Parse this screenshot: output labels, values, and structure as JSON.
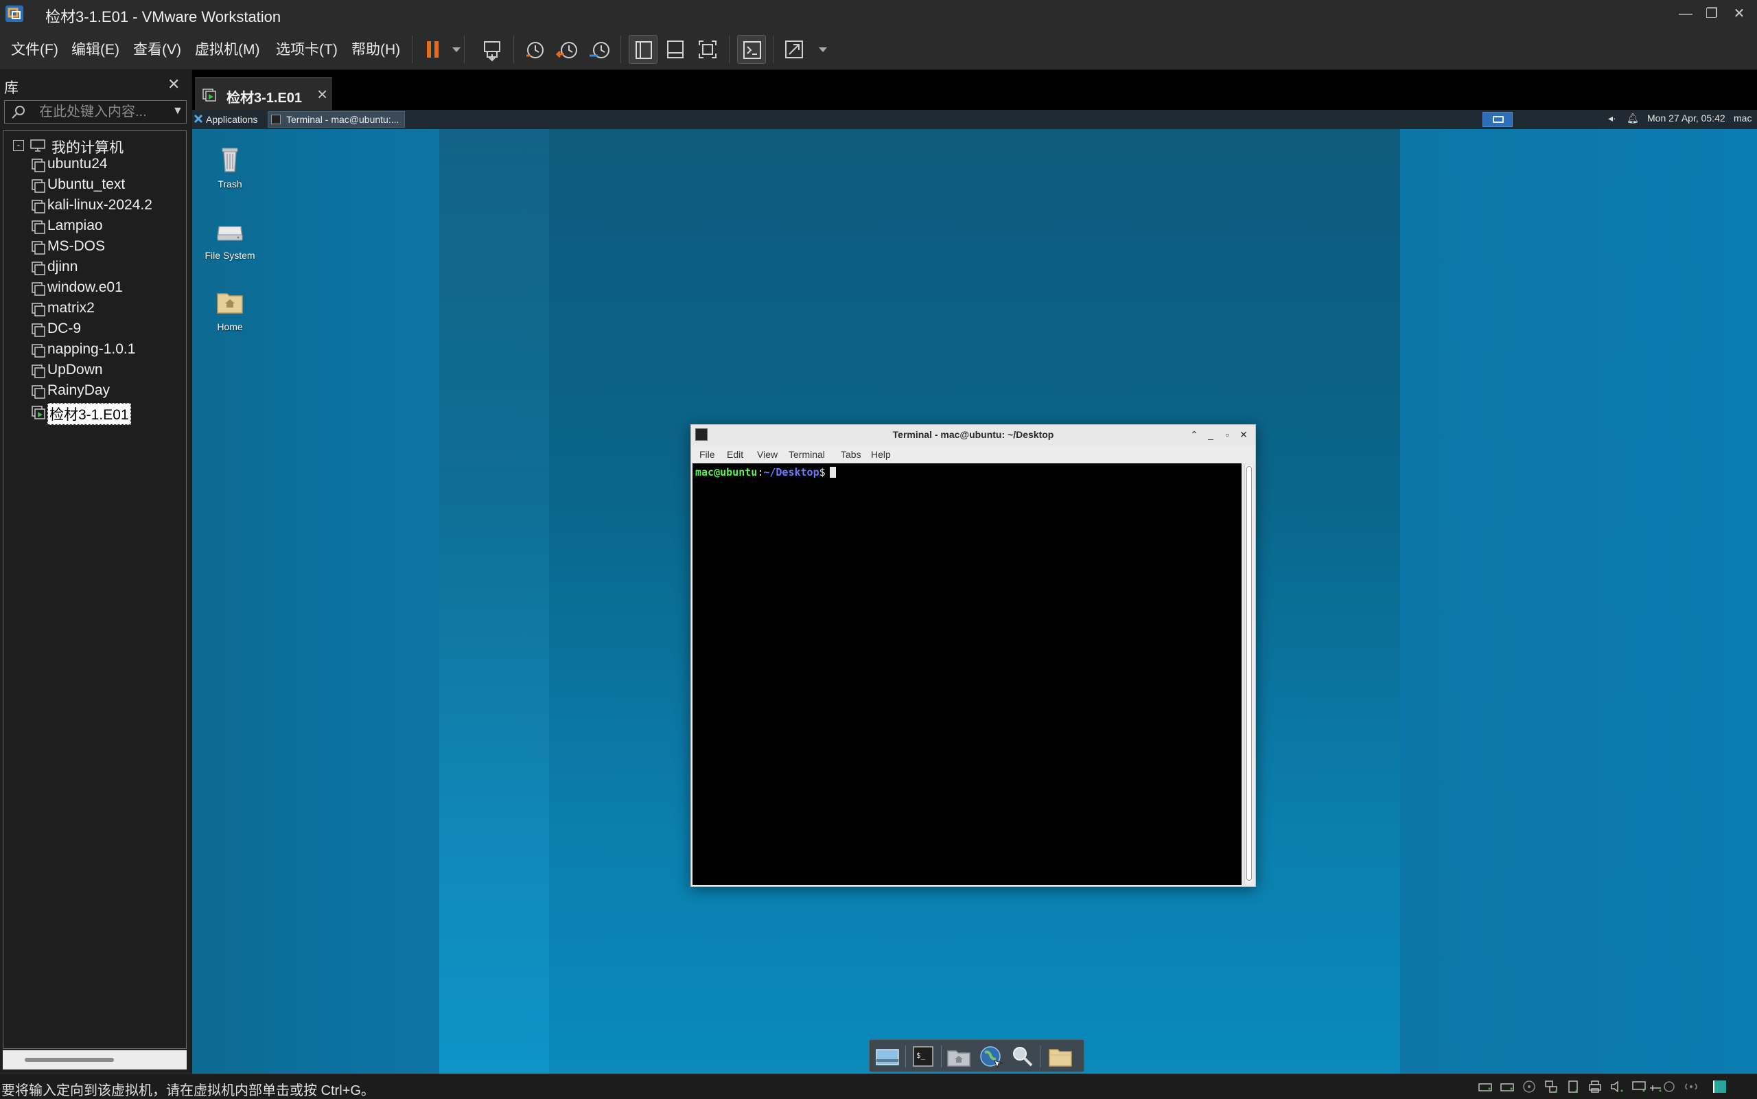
{
  "window": {
    "title": "检材3-1.E01 - VMware Workstation",
    "controls": [
      "minimize",
      "restore",
      "close"
    ]
  },
  "menu": {
    "items": [
      "文件(F)",
      "编辑(E)",
      "查看(V)",
      "虚拟机(M)",
      "选项卡(T)",
      "帮助(H)"
    ]
  },
  "toolbar": {
    "icons": [
      "pause-icon",
      "dropdown-icon",
      "send-ctrl-alt-del-icon",
      "snapshot-take-icon",
      "snapshot-revert-icon",
      "snapshot-manager-icon",
      "library-view-icon",
      "thumbnail-view-icon",
      "fullscreen-icon",
      "console-view-icon",
      "stretch-icon",
      "stretch-dropdown-icon"
    ],
    "accent": "#e46c1f"
  },
  "library": {
    "title": "库",
    "search_placeholder": "在此处键入内容...",
    "root_label": "我的计算机",
    "root_toggle": "-",
    "items": [
      {
        "label": "ubuntu24"
      },
      {
        "label": "Ubuntu_text"
      },
      {
        "label": "kali-linux-2024.2"
      },
      {
        "label": "Lampiao"
      },
      {
        "label": "MS-DOS"
      },
      {
        "label": "djinn"
      },
      {
        "label": "window.e01"
      },
      {
        "label": "matrix2"
      },
      {
        "label": "DC-9"
      },
      {
        "label": "napping-1.0.1"
      },
      {
        "label": "UpDown"
      },
      {
        "label": "RainyDay"
      },
      {
        "label": "检材3-1.E01",
        "selected": true,
        "running": true
      }
    ]
  },
  "tab": {
    "label": "检材3-1.E01"
  },
  "guest": {
    "panel": {
      "applications": "Applications",
      "task_label": "Terminal - mac@ubuntu:...",
      "clock": "Mon 27 Apr, 05:42",
      "user": "mac"
    },
    "desktop_icons": [
      {
        "label": "Trash",
        "icon": "trash-icon"
      },
      {
        "label": "File System",
        "icon": "drive-icon"
      },
      {
        "label": "Home",
        "icon": "home-folder-icon"
      }
    ],
    "terminal": {
      "title": "Terminal - mac@ubuntu: ~/Desktop",
      "menus": [
        "File",
        "Edit",
        "View",
        "Terminal",
        "Tabs",
        "Help"
      ],
      "prompt_user": "mac@ubuntu",
      "prompt_colon": ":",
      "prompt_path": "~/Desktop",
      "prompt_dollar": "$"
    },
    "dock": [
      "show-desktop-icon",
      "terminal-icon",
      "home-folder-icon",
      "browser-icon",
      "search-icon",
      "folder-icon"
    ],
    "background": "#0a7fb2"
  },
  "statusbar": {
    "text": "要将输入定向到该虚拟机，请在虚拟机内部单击或按 Ctrl+G。"
  }
}
